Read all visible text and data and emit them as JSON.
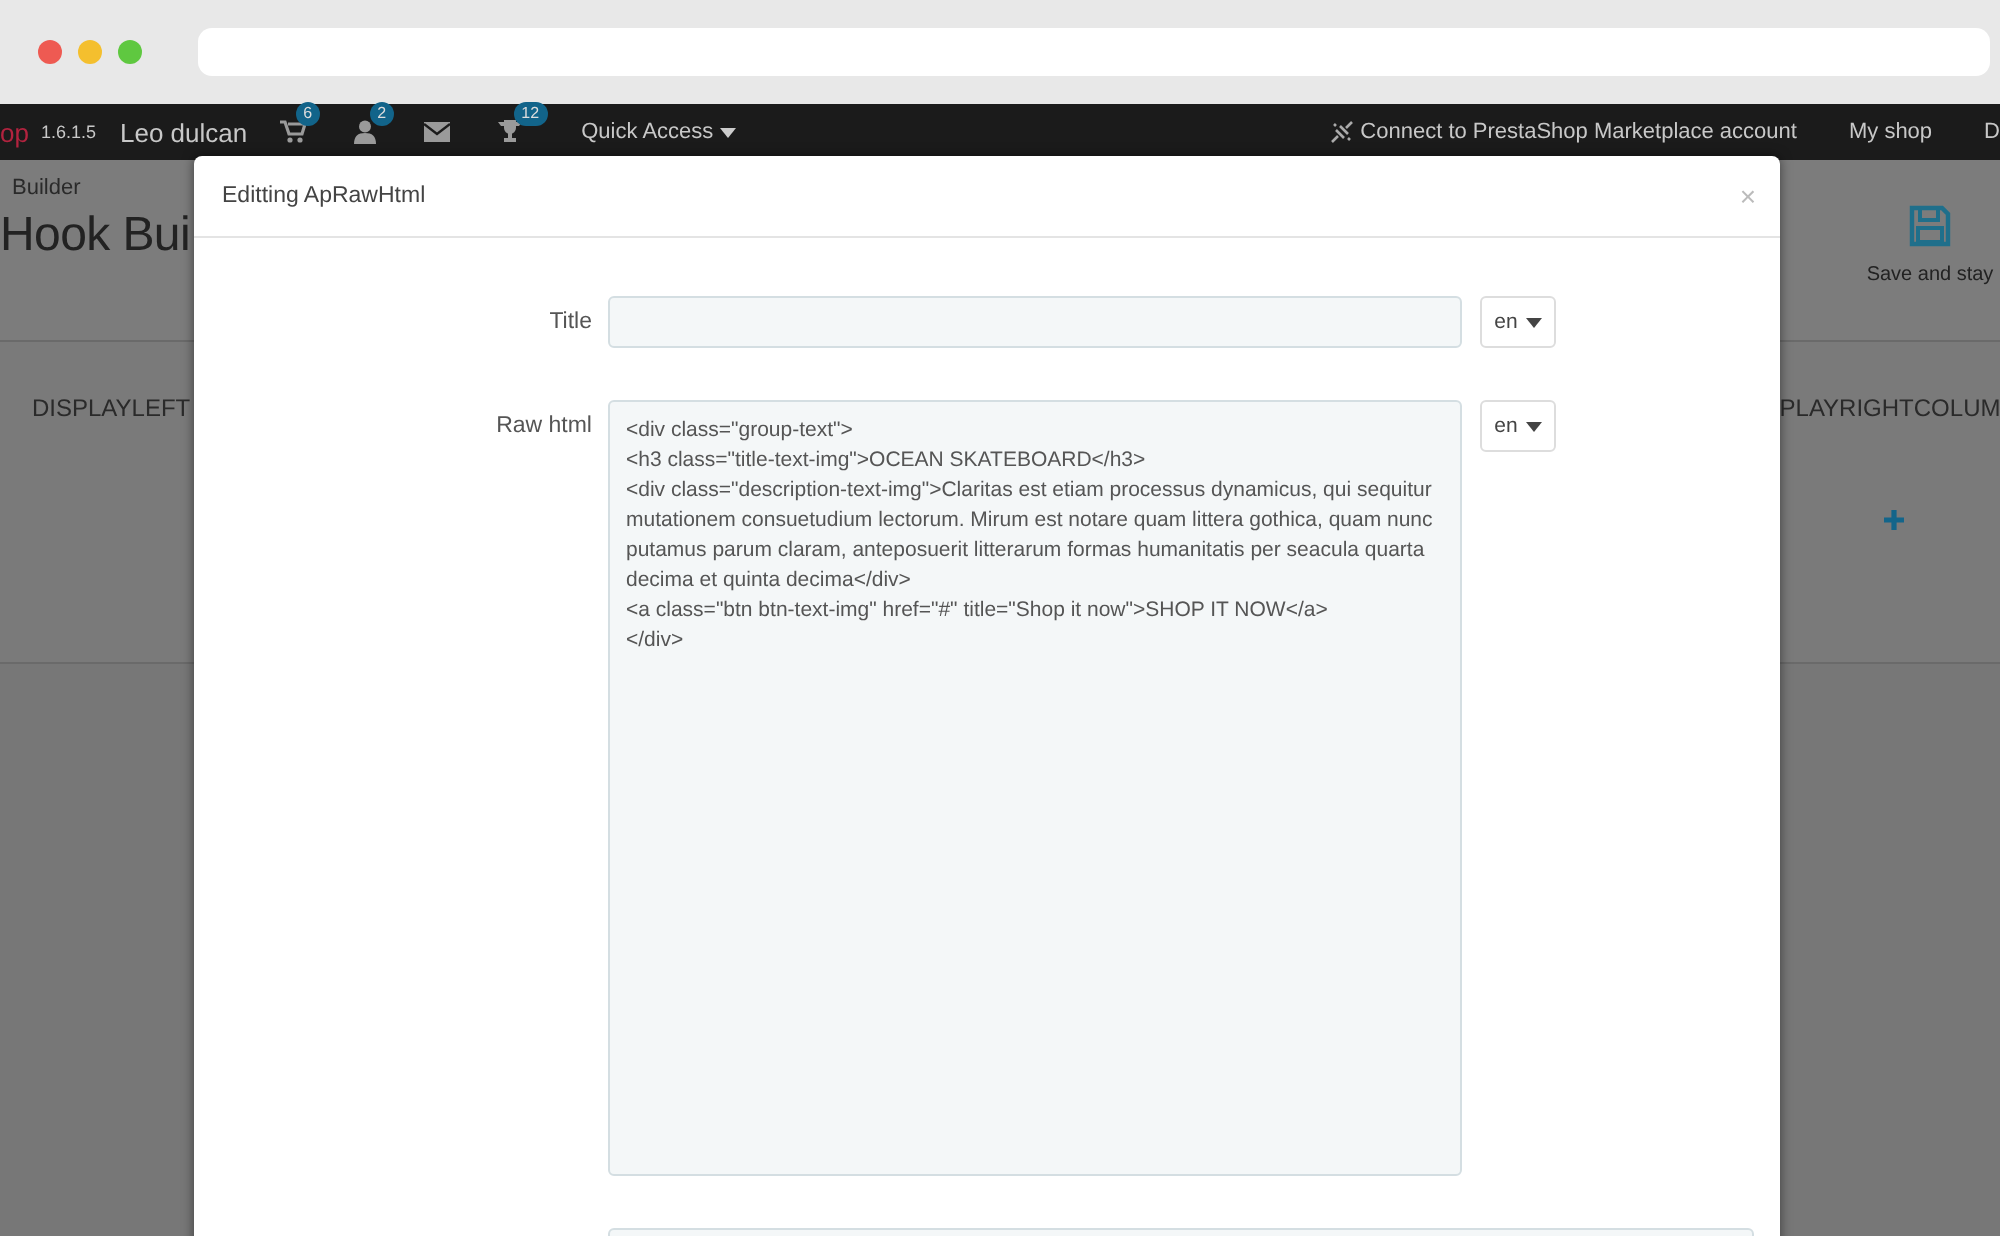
{
  "nav": {
    "logo": "op",
    "version": "1.6.1.5",
    "user": "Leo dulcan",
    "icons": [
      {
        "kind": "cart",
        "badge": "6"
      },
      {
        "kind": "user",
        "badge": "2"
      },
      {
        "kind": "mail"
      },
      {
        "kind": "trophy",
        "badge": "12"
      }
    ],
    "quick_access": "Quick Access",
    "connect": "Connect to PrestaShop Marketplace account",
    "links": [
      "My shop",
      "D"
    ]
  },
  "page": {
    "breadcrumb": "Builder",
    "title": "Hook Bui",
    "save": "Save and stay",
    "hooks": [
      {
        "name": "DISPLAYLEFT"
      },
      {
        "name": "PLAYRIGHTCOLUM"
      }
    ]
  },
  "modal": {
    "title": "Editting ApRawHtml",
    "close": "×",
    "fields": [
      {
        "kind": "input",
        "label": "Title",
        "lang": "en"
      },
      {
        "kind": "textarea",
        "label": "Raw html",
        "lang": "en",
        "value": "<div class=\"group-text\">\n<h3 class=\"title-text-img\">OCEAN SKATEBOARD</h3>\n<div class=\"description-text-img\">Claritas est etiam processus dynamicus, qui sequitur mutationem consuetudium lectorum. Mirum est notare quam littera gothica, quam nunc putamus parum claram, anteposuerit litterarum formas humanitatis per seacula quarta decima et quinta decima</div>\n<a class=\"btn btn-text-img\" href=\"#\" title=\"Shop it now\">SHOP IT NOW</a>\n</div>"
      },
      {
        "kind": "wide-input"
      }
    ]
  }
}
